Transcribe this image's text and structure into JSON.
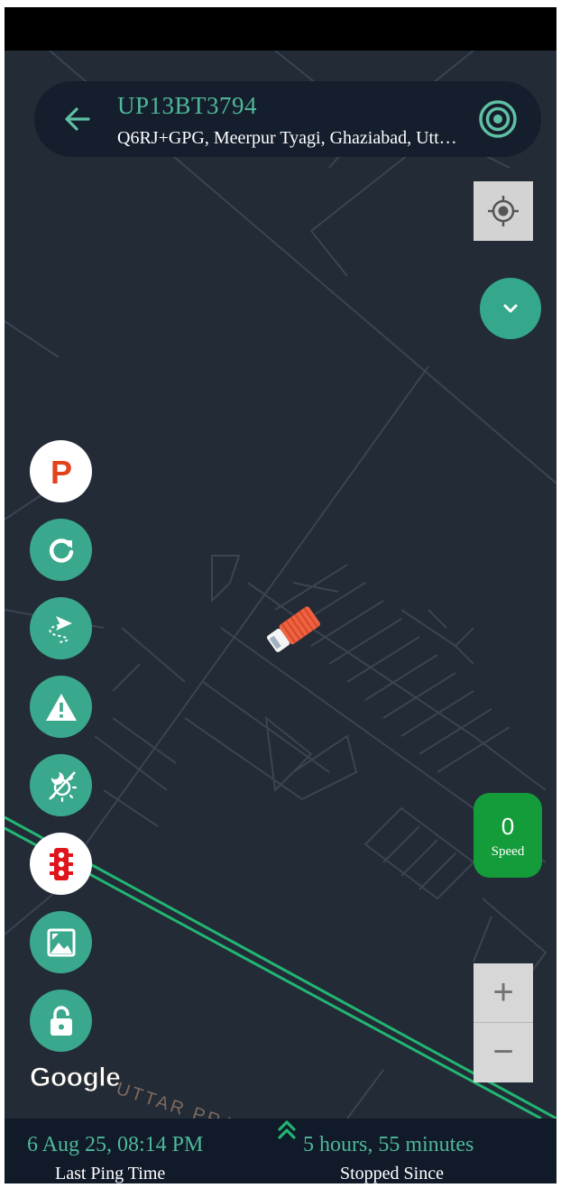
{
  "header": {
    "vehicle_number": "UP13BT3794",
    "location": "Q6RJ+GPG, Meerpur Tyagi, Ghaziabad, Uttar Pradesh"
  },
  "map": {
    "region_label": "UTTAR PRA",
    "attribution": "Google",
    "zoom_in_label": "+",
    "zoom_out_label": "−"
  },
  "speed": {
    "value": "0",
    "label": "Speed"
  },
  "left_toolbar": [
    {
      "icon": "parking-icon",
      "label": "P"
    },
    {
      "icon": "refresh-icon"
    },
    {
      "icon": "route-playback-icon"
    },
    {
      "icon": "alert-icon"
    },
    {
      "icon": "day-night-icon"
    },
    {
      "icon": "traffic-light-icon"
    },
    {
      "icon": "map-type-icon"
    },
    {
      "icon": "lock-icon"
    }
  ],
  "footer": {
    "last_ping_value": "6 Aug 25, 08:14 PM",
    "last_ping_label": "Last Ping Time",
    "stopped_value": "5 hours, 55 minutes",
    "stopped_label": "Stopped Since"
  },
  "colors": {
    "accent": "#3aa88c",
    "map_bg": "#222b36",
    "header_bg": "#151e2c",
    "speed_bg": "#149c3a",
    "parking_red": "#e2431d",
    "route_green": "#22b573"
  }
}
